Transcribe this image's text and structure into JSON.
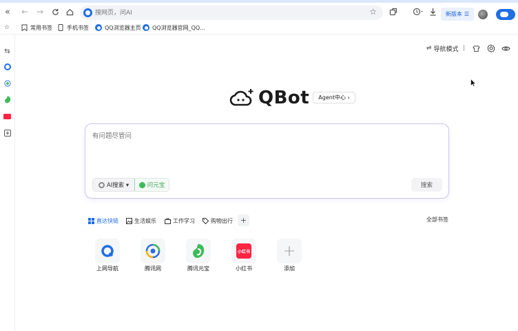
{
  "browser": {
    "omnibox_placeholder": "搜网页，问AI",
    "new_version_label": "新版本",
    "new_version_icon": "☰",
    "bookmarks": [
      {
        "label": "常用书签",
        "icon": "bookmark-add-icon"
      },
      {
        "label": "手机书签",
        "icon": "phone-icon"
      },
      {
        "label": "QQ浏览器主页",
        "icon": "qq-browser-icon"
      },
      {
        "label": "QQ浏览器官网_QQ...",
        "icon": "qq-browser-icon"
      }
    ]
  },
  "header": {
    "nav_mode_label": "导航模式",
    "nav_mode_icon": "⇌",
    "separator": "|"
  },
  "brand": {
    "logo_text": "QBot",
    "agent_label": "Agent中心 ›",
    "accent_color": "#1f6fe5"
  },
  "search": {
    "placeholder": "有问题尽管问",
    "ai_search_label": "AI搜索 ▾",
    "yuanbao_label": "问元宝",
    "submit_label": "搜索"
  },
  "categories": {
    "tabs": [
      {
        "label": "直达快链",
        "icon": "grid-icon"
      },
      {
        "label": "生活娱乐",
        "icon": "picture-icon"
      },
      {
        "label": "工作学习",
        "icon": "briefcase-icon"
      },
      {
        "label": "购物出行",
        "icon": "tag-icon"
      }
    ],
    "add_symbol": "+",
    "all_bookmarks_label": "全部书签"
  },
  "shortcuts": [
    {
      "label": "上网导航",
      "icon": "qq-nav-icon",
      "color": "#1f6fe5"
    },
    {
      "label": "腾讯网",
      "icon": "tencent-news-icon",
      "color": "#2b6de0"
    },
    {
      "label": "腾讯元宝",
      "icon": "yuanbao-icon",
      "color": "#3dbb5a"
    },
    {
      "label": "小红书",
      "icon": "xiaohongshu-icon",
      "color": "#ff2442",
      "badge": "小红书"
    },
    {
      "label": "添加",
      "icon": "add-icon",
      "symbol": "+"
    }
  ]
}
